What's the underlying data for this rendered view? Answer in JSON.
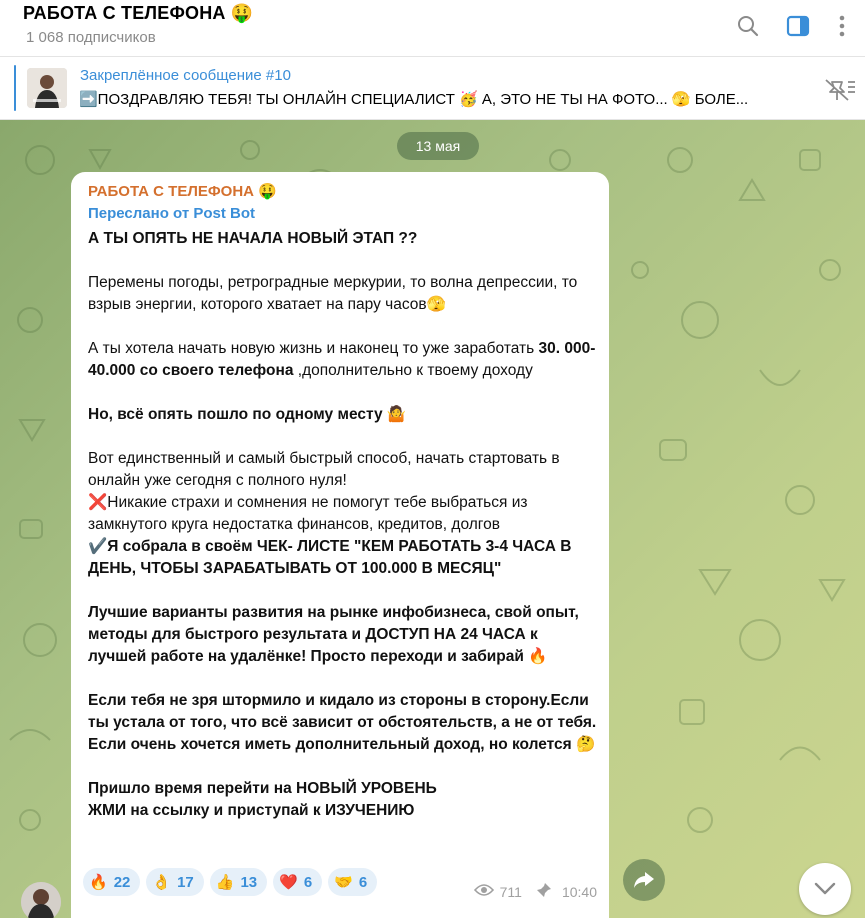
{
  "header": {
    "title": "РАБОТА С ТЕЛЕФОНА 🤑",
    "subscribers": "1 068 подписчиков",
    "search_icon": "search-icon",
    "sidebar_icon": "sidebar-toggle-icon",
    "menu_icon": "more-vertical-icon"
  },
  "pinned": {
    "title": "Закреплённое сообщение #10",
    "text": "➡️ПОЗДРАВЛЯЮ ТЕБЯ! ТЫ ОНЛАЙН СПЕЦИАЛИСТ 🥳   А, ЭТО НЕ ТЫ НА ФОТО... 🫣  БОЛЕ...",
    "thumb_icon": "pinned-thumbnail"
  },
  "chat": {
    "date": "13 мая",
    "message": {
      "author": "РАБОТА С ТЕЛЕФОНА 🤑",
      "forwarded": "Переслано от Post Bot",
      "line1": "А ТЫ ОПЯТЬ НЕ НАЧАЛА НОВЫЙ ЭТАП ??",
      "line2": "Перемены погоды, ретроградные меркурии, то волна депрессии, то взрыв энергии, которого хватает на пару часов🫣",
      "line3_a": "А ты хотела начать новую жизнь и наконец то уже заработать ",
      "line3_b": "30. 000-40.000 со своего телефона",
      "line3_c": " ,дополнительно к твоему доходу",
      "line4": "Но, всё опять пошло по одному месту 🤷",
      "line5": "Вот единственный и самый быстрый способ, начать стартовать в онлайн уже сегодня с полного нуля!",
      "line6": "❌Никакие страхи и сомнения не помогут тебе выбраться из замкнутого круга недостатка финансов, кредитов, долгов",
      "line7": "✔️Я собрала в своём ЧЕК- ЛИСТЕ \"КЕМ РАБОТАТЬ 3-4 ЧАСА В ДЕНЬ, ЧТОБЫ ЗАРАБАТЫВАТЬ ОТ 100.000 В МЕСЯЦ\"",
      "line8": "Лучшие варианты развития на рынке инфобизнеса, свой опыт, методы для быстрого результата и  ДОСТУП НА 24 ЧАСА к лучшей работе на удалёнке! Просто переходи и забирай 🔥",
      "line9": "Если тебя не зря штормило и кидало из стороны в сторону.Если ты устала от того, что всё зависит от обстоятельств, а не от тебя. Если очень хочется иметь дополнительный доход, но колется 🤔",
      "line10": "Пришло время перейти на НОВЫЙ УРОВЕНЬ",
      "line11": "ЖМИ на ссылку и приступай к ИЗУЧЕНИЮ",
      "reactions": [
        {
          "emoji": "🔥",
          "count": "22"
        },
        {
          "emoji": "👌",
          "count": "17"
        },
        {
          "emoji": "👍",
          "count": "13"
        },
        {
          "emoji": "❤️",
          "count": "6"
        },
        {
          "emoji": "🤝",
          "count": "6"
        }
      ],
      "views": "711",
      "time": "10:40"
    }
  },
  "colors": {
    "accent": "#3a8ed8",
    "author": "#d4702e",
    "chat_bg_start": "#8aa86c",
    "chat_bg_end": "#cbd58f"
  }
}
